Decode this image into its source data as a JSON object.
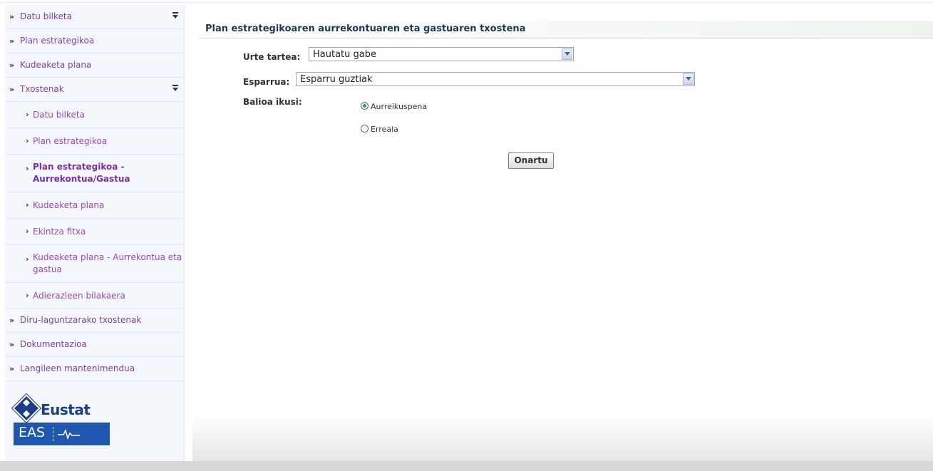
{
  "sidebar": {
    "items": [
      {
        "label": "Datu bilketa",
        "expandable": true
      },
      {
        "label": "Plan estrategikoa",
        "expandable": false
      },
      {
        "label": "Kudeaketa plana",
        "expandable": false
      },
      {
        "label": "Txostenak",
        "expandable": true
      }
    ],
    "subitems": [
      {
        "label": "Datu bilketa"
      },
      {
        "label": "Plan estrategikoa"
      },
      {
        "label": "Plan estrategikoa - Aurrekontua/Gastua",
        "active": true
      },
      {
        "label": "Kudeaketa plana"
      },
      {
        "label": "Ekintza fitxa"
      },
      {
        "label": "Kudeaketa plana - Aurrekontua eta gastua"
      },
      {
        "label": "Adierazleen bilakaera"
      }
    ],
    "items_after": [
      {
        "label": "Diru-laguntzarako txostenak"
      },
      {
        "label": "Dokumentazioa"
      },
      {
        "label": "Langileen mantenimendua"
      }
    ],
    "logo": {
      "top_text": "Eustat",
      "bottom_text": "EAS"
    }
  },
  "main": {
    "title": "Plan estrategikoaren aurrekontuaren eta gastuaren txostena",
    "urte_tartea": {
      "label": "Urte tartea:",
      "value": "Hautatu gabe"
    },
    "esparrua": {
      "label": "Esparrua:",
      "value": "Esparru guztiak"
    },
    "balioa": {
      "label": "Balioa ikusi:",
      "options": [
        {
          "label": "Aurreikuspena",
          "checked": true
        },
        {
          "label": "Erreala",
          "checked": false
        }
      ]
    },
    "submit_label": "Onartu"
  },
  "colors": {
    "link": "#7e3fa8",
    "active": "#7b2fa6",
    "title": "#1f3850",
    "sidebar_bg": "#f4f8fc",
    "logo_blue": "#1b3f86"
  }
}
